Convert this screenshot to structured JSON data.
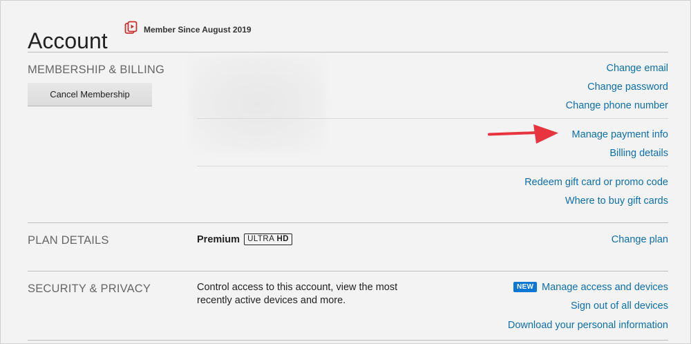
{
  "page": {
    "title": "Account"
  },
  "member_since": {
    "text": "Member Since August 2019",
    "icon": "member-badge-icon",
    "accent": "#c9302c"
  },
  "membership": {
    "title": "MEMBERSHIP & BILLING",
    "cancel_label": "Cancel Membership",
    "links": {
      "change_email": "Change email",
      "change_password": "Change password",
      "change_phone": "Change phone number",
      "manage_payment": "Manage payment info",
      "billing_details": "Billing details",
      "redeem_gift": "Redeem gift card or promo code",
      "where_to_buy": "Where to buy gift cards"
    }
  },
  "plan": {
    "title": "PLAN DETAILS",
    "name": "Premium",
    "quality_badge_light": "ULTRA ",
    "quality_badge_bold": "HD",
    "change_plan": "Change plan"
  },
  "security": {
    "title": "SECURITY & PRIVACY",
    "description": "Control access to this account, view the most recently active devices and more.",
    "new_badge": "NEW",
    "manage_access": "Manage access and devices",
    "sign_out_all": "Sign out of all devices",
    "download_info": "Download your personal information"
  },
  "colors": {
    "link": "#0c6fb0",
    "annotation_arrow": "#e8343f",
    "new_badge": "#0c78d4"
  }
}
